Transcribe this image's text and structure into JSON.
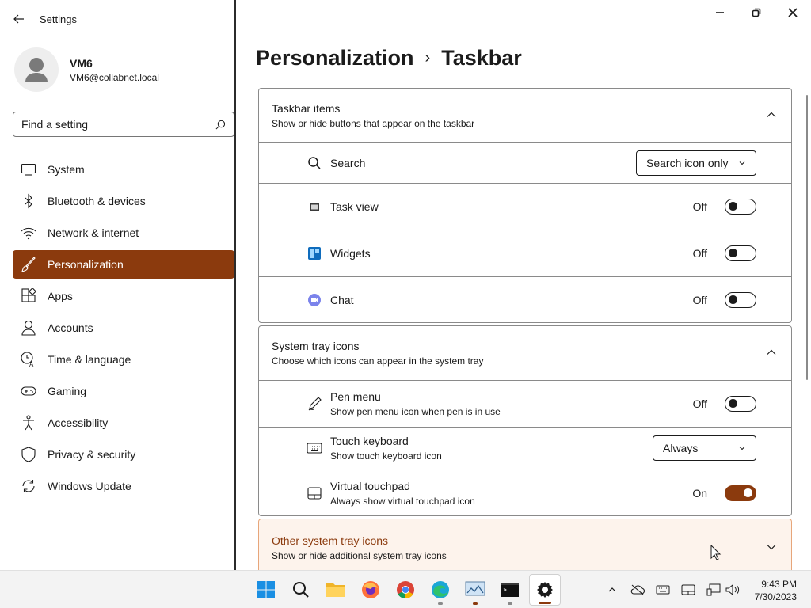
{
  "app": {
    "title": "Settings"
  },
  "user": {
    "name": "VM6",
    "email": "VM6@collabnet.local"
  },
  "search": {
    "placeholder": "Find a setting"
  },
  "sidebar": {
    "items": [
      {
        "label": "System",
        "icon": "laptop-icon"
      },
      {
        "label": "Bluetooth & devices",
        "icon": "bluetooth-icon"
      },
      {
        "label": "Network & internet",
        "icon": "wifi-icon"
      },
      {
        "label": "Personalization",
        "icon": "brush-icon",
        "active": true
      },
      {
        "label": "Apps",
        "icon": "apps-icon"
      },
      {
        "label": "Accounts",
        "icon": "person-icon"
      },
      {
        "label": "Time & language",
        "icon": "clock-language-icon"
      },
      {
        "label": "Gaming",
        "icon": "gamepad-icon"
      },
      {
        "label": "Accessibility",
        "icon": "accessibility-icon"
      },
      {
        "label": "Privacy & security",
        "icon": "shield-icon"
      },
      {
        "label": "Windows Update",
        "icon": "update-icon"
      }
    ]
  },
  "breadcrumb": {
    "parent": "Personalization",
    "separator": "›",
    "current": "Taskbar"
  },
  "taskbar_items": {
    "title": "Taskbar items",
    "subtitle": "Show or hide buttons that appear on the taskbar",
    "rows": {
      "search": {
        "label": "Search",
        "value": "Search icon only"
      },
      "task_view": {
        "label": "Task view",
        "state": "Off"
      },
      "widgets": {
        "label": "Widgets",
        "state": "Off"
      },
      "chat": {
        "label": "Chat",
        "state": "Off"
      }
    }
  },
  "system_tray": {
    "title": "System tray icons",
    "subtitle": "Choose which icons can appear in the system tray",
    "rows": {
      "pen_menu": {
        "label": "Pen menu",
        "sub": "Show pen menu icon when pen is in use",
        "state": "Off"
      },
      "touch_keyboard": {
        "label": "Touch keyboard",
        "sub": "Show touch keyboard icon",
        "value": "Always"
      },
      "virtual_touchpad": {
        "label": "Virtual touchpad",
        "sub": "Always show virtual touchpad icon",
        "state": "On"
      }
    }
  },
  "other_tray": {
    "title": "Other system tray icons",
    "subtitle": "Show or hide additional system tray icons"
  },
  "clock": {
    "time": "9:43 PM",
    "date": "7/30/2023"
  },
  "colors": {
    "accent": "#8b3a0d",
    "accent_light_bg": "#fdf3ec"
  }
}
